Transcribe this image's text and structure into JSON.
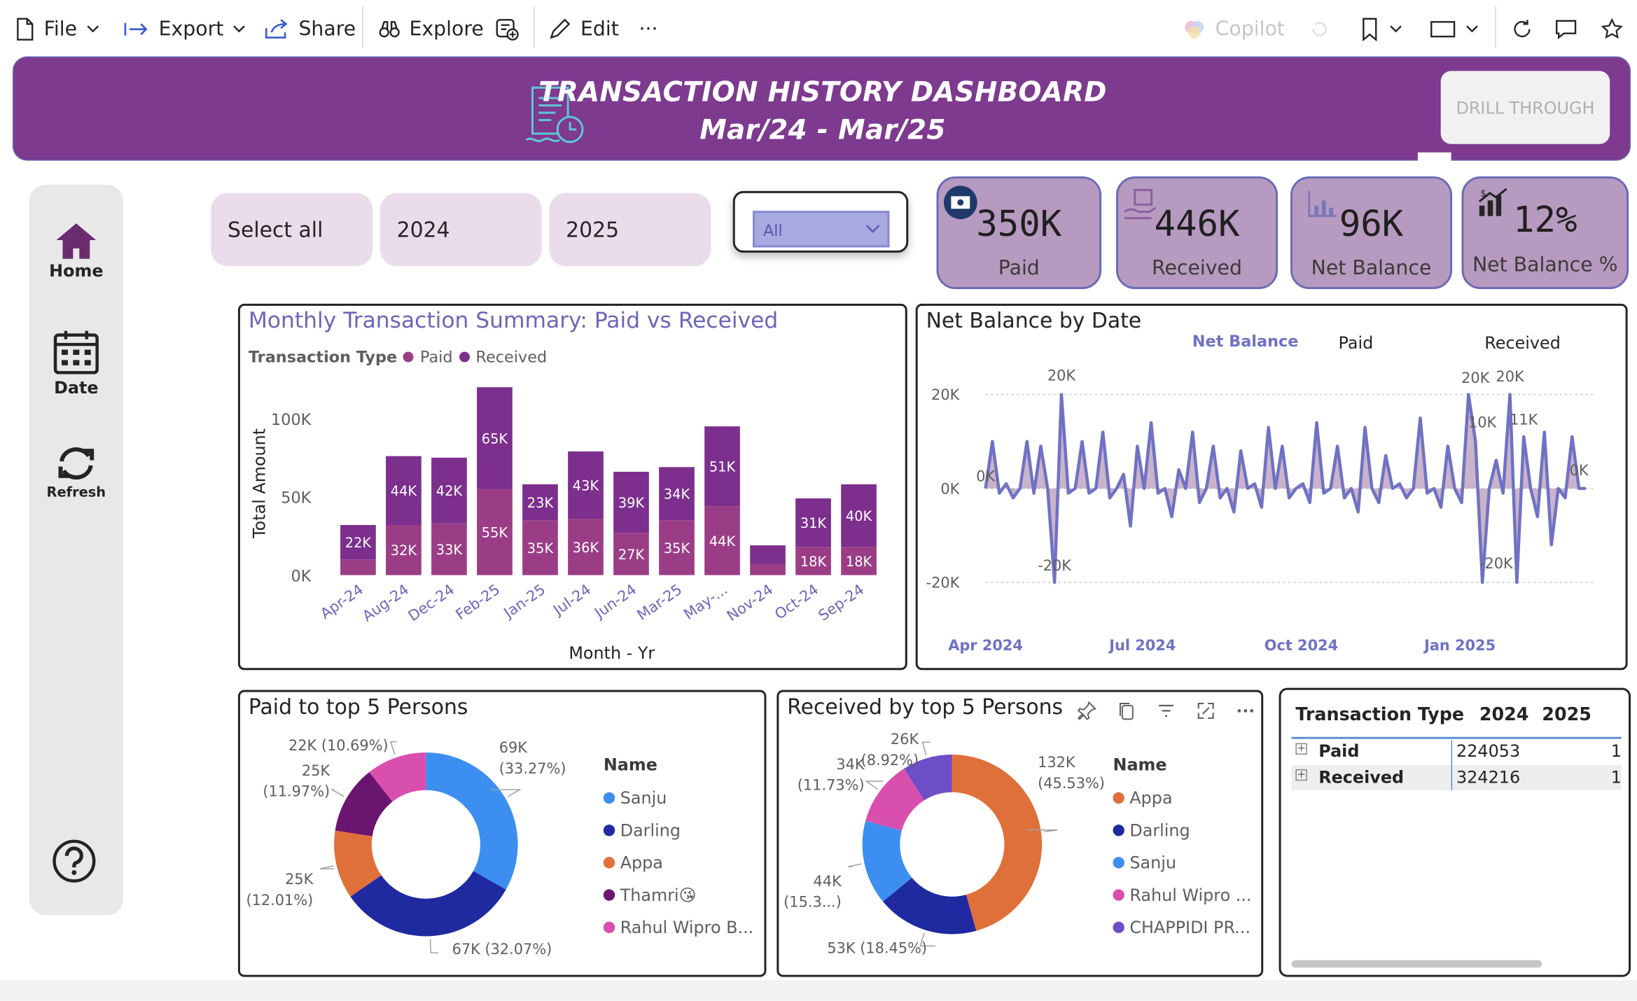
{
  "toolbar": {
    "file": "File",
    "export": "Export",
    "share": "Share",
    "explore": "Explore",
    "edit": "Edit",
    "more": "···",
    "copilot": "Copilot"
  },
  "banner": {
    "title": "TRANSACTION HISTORY DASHBOARD",
    "subtitle": "Mar/24 - Mar/25",
    "drill": "DRILL THROUGH"
  },
  "nav": {
    "home": "Home",
    "date": "Date",
    "refresh": "Refresh"
  },
  "slicers": {
    "select_all": "Select all",
    "y2024": "2024",
    "y2025": "2025",
    "dropdown": "All"
  },
  "kpis": [
    {
      "value": "350K",
      "label": "Paid"
    },
    {
      "value": "446K",
      "label": "Received"
    },
    {
      "value": "96K",
      "label": "Net Balance"
    },
    {
      "value": "12%",
      "label": "Net Balance %"
    }
  ],
  "colors": {
    "banner": "#7d3a8f",
    "paid_bar": "#9b3d86",
    "received_bar": "#7c2f8d",
    "donut_sanju": "#3c8ff0",
    "donut_darling": "#1f2aa0",
    "donut_appa": "#e0703a",
    "donut_thamri": "#6a1570",
    "donut_rahul": "#d94fae",
    "donut_chappidi": "#6e4ec6",
    "line": "#6f72c4",
    "fill": "#b89bb8"
  },
  "monthly": {
    "title": "Monthly Transaction Summary: Paid vs Received",
    "legend_title": "Transaction Type",
    "legend_paid": "Paid",
    "legend_received": "Received",
    "ylabel": "Total Amount",
    "xlabel": "Month - Yr",
    "yticks": [
      "0K",
      "50K",
      "100K"
    ]
  },
  "netbal": {
    "title": "Net Balance by Date",
    "legend_net": "Net Balance",
    "legend_paid": "Paid",
    "legend_received": "Received",
    "yticks": [
      "-20K",
      "0K",
      "20K"
    ],
    "xticks": [
      "Apr 2024",
      "Jul 2024",
      "Oct 2024",
      "Jan 2025"
    ],
    "annotations": [
      "0K",
      "20K",
      "-20K",
      "20K",
      "10K",
      "-20K",
      "20K",
      "11K",
      "0K"
    ]
  },
  "paid_donut": {
    "title": "Paid to top 5 Persons",
    "legend_title": "Name",
    "legend": [
      "Sanju",
      "Darling",
      "Appa",
      "Thamri😘",
      "Rahul Wipro B..."
    ]
  },
  "recv_donut": {
    "title": "Received by top 5 Persons",
    "legend_title": "Name",
    "legend": [
      "Appa",
      "Darling",
      "Sanju",
      "Rahul Wipro ...",
      "CHAPPIDI PR..."
    ]
  },
  "matrix": {
    "headers": [
      "Transaction Type",
      "2024",
      "2025"
    ],
    "rows": [
      {
        "type": "Paid",
        "y2024": "224053",
        "y2025": "1"
      },
      {
        "type": "Received",
        "y2024": "324216",
        "y2025": "1"
      }
    ]
  },
  "chart_data": [
    {
      "type": "bar",
      "title": "Monthly Transaction Summary: Paid vs Received",
      "xlabel": "Month - Yr",
      "ylabel": "Total Amount",
      "ylim": [
        0,
        120000
      ],
      "stacked": true,
      "categories": [
        "Apr-24",
        "Aug-24",
        "Dec-24",
        "Feb-25",
        "Jan-25",
        "Jul-24",
        "Jun-24",
        "Mar-25",
        "May-...",
        "Nov-24",
        "Oct-24",
        "Sep-24"
      ],
      "series": [
        {
          "name": "Paid",
          "values": [
            10000,
            32000,
            33000,
            55000,
            35000,
            36000,
            27000,
            35000,
            44000,
            7000,
            18000,
            18000
          ],
          "labels": [
            "",
            "32K",
            "33K",
            "55K",
            "35K",
            "36K",
            "27K",
            "35K",
            "44K",
            "",
            "18K",
            "18K"
          ]
        },
        {
          "name": "Received",
          "values": [
            22000,
            44000,
            42000,
            65000,
            23000,
            43000,
            39000,
            34000,
            51000,
            12000,
            31000,
            40000
          ],
          "labels": [
            "22K",
            "44K",
            "42K",
            "65K",
            "23K",
            "43K",
            "39K",
            "34K",
            "51K",
            "",
            "31K",
            "40K"
          ]
        }
      ],
      "legend": "top-left"
    },
    {
      "type": "line",
      "title": "Net Balance by Date",
      "series_name": "Net Balance",
      "ylim": [
        -25000,
        25000
      ],
      "x": [
        "2024-04-01",
        "2024-04-05",
        "2024-04-09",
        "2024-04-13",
        "2024-04-17",
        "2024-04-21",
        "2024-04-25",
        "2024-04-29",
        "2024-05-03",
        "2024-05-07",
        "2024-05-11",
        "2024-05-15",
        "2024-05-19",
        "2024-05-23",
        "2024-05-27",
        "2024-05-31",
        "2024-06-04",
        "2024-06-08",
        "2024-06-12",
        "2024-06-16",
        "2024-06-20",
        "2024-06-24",
        "2024-06-28",
        "2024-07-02",
        "2024-07-06",
        "2024-07-10",
        "2024-07-14",
        "2024-07-18",
        "2024-07-22",
        "2024-07-26",
        "2024-07-30",
        "2024-08-03",
        "2024-08-07",
        "2024-08-11",
        "2024-08-15",
        "2024-08-19",
        "2024-08-23",
        "2024-08-27",
        "2024-08-31",
        "2024-09-04",
        "2024-09-08",
        "2024-09-12",
        "2024-09-16",
        "2024-09-20",
        "2024-09-24",
        "2024-09-28",
        "2024-10-02",
        "2024-10-06",
        "2024-10-10",
        "2024-10-14",
        "2024-10-18",
        "2024-10-22",
        "2024-10-26",
        "2024-10-30",
        "2024-11-03",
        "2024-11-07",
        "2024-11-11",
        "2024-11-15",
        "2024-11-19",
        "2024-11-23",
        "2024-11-27",
        "2024-12-01",
        "2024-12-05",
        "2024-12-09",
        "2024-12-13",
        "2024-12-17",
        "2024-12-21",
        "2024-12-25",
        "2024-12-29",
        "2025-01-02",
        "2025-01-06",
        "2025-01-10",
        "2025-01-14",
        "2025-01-18",
        "2025-01-22",
        "2025-01-26",
        "2025-01-30",
        "2025-02-03",
        "2025-02-07",
        "2025-02-11",
        "2025-02-15",
        "2025-02-19",
        "2025-02-23",
        "2025-02-27",
        "2025-03-03",
        "2025-03-07",
        "2025-03-11",
        "2025-03-15"
      ],
      "y": [
        0,
        10000,
        -1000,
        1000,
        -2000,
        0,
        10000,
        -1000,
        9000,
        0,
        -20000,
        20000,
        -1000,
        0,
        10000,
        -1000,
        0,
        12000,
        -2000,
        0,
        3000,
        -8000,
        9000,
        0,
        14000,
        -1000,
        0,
        -6000,
        4000,
        0,
        12000,
        -3000,
        0,
        9000,
        -2000,
        0,
        -5000,
        8000,
        0,
        1000,
        -4000,
        13000,
        0,
        9000,
        -2000,
        0,
        1000,
        -3000,
        14000,
        -1000,
        0,
        9000,
        -2000,
        0,
        -5000,
        13000,
        0,
        -3000,
        7000,
        0,
        1000,
        -2000,
        0,
        15000,
        -1000,
        0,
        -4000,
        9000,
        0,
        -3000,
        20000,
        10000,
        -20000,
        0,
        6000,
        -1000,
        20000,
        -20000,
        11000,
        0,
        -6000,
        12000,
        -12000,
        0,
        -2000,
        11000,
        0,
        0
      ],
      "xticks": [
        "Apr 2024",
        "Jul 2024",
        "Oct 2024",
        "Jan 2025"
      ],
      "yticks": [
        "-20K",
        "0K",
        "20K"
      ]
    },
    {
      "type": "pie",
      "title": "Paid to top 5 Persons",
      "categories": [
        "Sanju",
        "Darling",
        "Appa",
        "Thamri😘",
        "Rahul Wipro B..."
      ],
      "values": [
        69000,
        67000,
        25000,
        25000,
        22000
      ],
      "percents": [
        33.27,
        32.07,
        12.01,
        11.97,
        10.69
      ],
      "labels": [
        "69K (33.27%)",
        "67K (32.07%)",
        "25K (12.01%)",
        "25K (11.97%)",
        "22K (10.69%)"
      ]
    },
    {
      "type": "pie",
      "title": "Received by top 5 Persons",
      "categories": [
        "Appa",
        "Darling",
        "Sanju",
        "Rahul Wipro ...",
        "CHAPPIDI PR..."
      ],
      "values": [
        132000,
        53000,
        44000,
        34000,
        26000
      ],
      "percents": [
        45.53,
        18.45,
        15.3,
        11.73,
        8.92
      ],
      "labels": [
        "132K (45.53%)",
        "53K (18.45%)",
        "44K (15.3...)",
        "34K (11.73%)",
        "26K (8.92%)"
      ]
    },
    {
      "type": "table",
      "columns": [
        "Transaction Type",
        "2024",
        "2025"
      ],
      "rows": [
        [
          "Paid",
          "224053",
          "1"
        ],
        [
          "Received",
          "324216",
          "1"
        ]
      ]
    }
  ]
}
